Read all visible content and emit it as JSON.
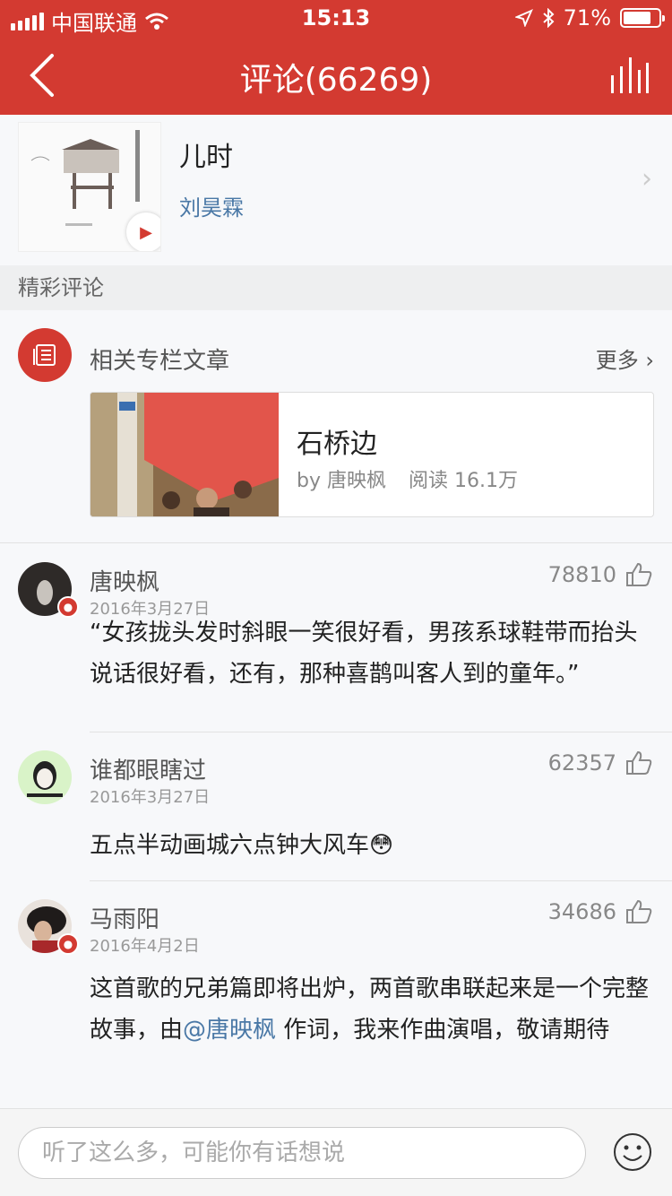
{
  "status": {
    "carrier": "中国联通",
    "time": "15:13",
    "battery": "71%"
  },
  "nav": {
    "title": "评论(66269)"
  },
  "song": {
    "title": "儿时",
    "artist": "刘昊霖"
  },
  "section": {
    "label": "精彩评论"
  },
  "related": {
    "title": "相关专栏文章",
    "more": "更多",
    "article": {
      "name": "石桥边",
      "by": "by 唐映枫",
      "reads": "阅读 16.1万"
    }
  },
  "comments": [
    {
      "name": "唐映枫",
      "date": "2016年3月27日",
      "likes": "78810",
      "text": "“女孩拢头发时斜眼一笑很好看，男孩系球鞋带而抬头说话很好看，还有，那种喜鹊叫客人到的童年。”"
    },
    {
      "name": "谁都眼瞎过",
      "date": "2016年3月27日",
      "likes": "62357",
      "text": "五点半动画城六点钟大风车😳"
    },
    {
      "name": "马雨阳",
      "date": "2016年4月2日",
      "likes": "34686",
      "text_before": "这首歌的兄弟篇即将出炉，两首歌串联起来是一个完整故事，由",
      "mention": "@唐映枫",
      "text_after": " 作词，我来作曲演唱，敬请期待"
    }
  ],
  "input": {
    "placeholder": "听了这么多，可能你有话想说"
  }
}
